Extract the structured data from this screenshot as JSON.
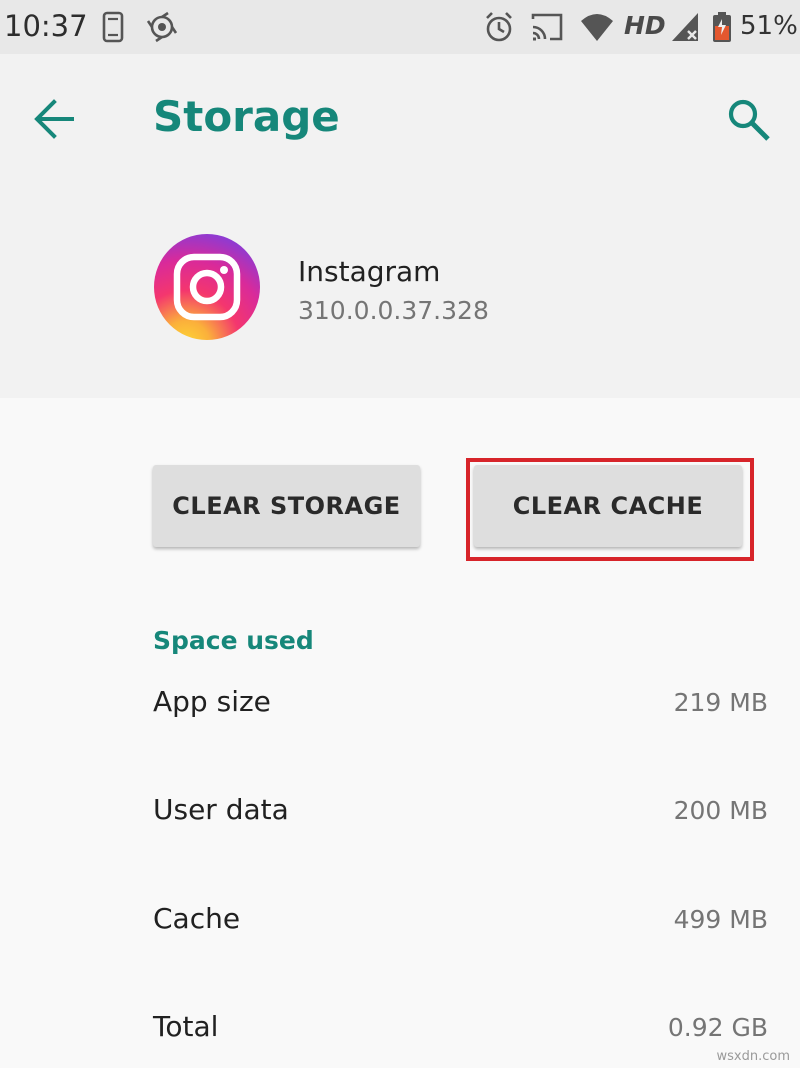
{
  "status_bar": {
    "time": "10:37",
    "network": "HD",
    "battery_percent": "51%",
    "icons": [
      "phone-icon",
      "sync-icon",
      "alarm-icon",
      "cast-icon",
      "wifi-icon",
      "cell-signal-icon",
      "battery-icon"
    ]
  },
  "header": {
    "title": "Storage",
    "back_icon": "arrow-back-icon",
    "search_icon": "search-icon"
  },
  "app": {
    "name": "Instagram",
    "version": "310.0.0.37.328",
    "icon": "instagram-icon"
  },
  "actions": {
    "clear_storage_label": "CLEAR STORAGE",
    "clear_cache_label": "CLEAR CACHE"
  },
  "space_used": {
    "header": "Space used",
    "rows": [
      {
        "label": "App size",
        "value": "219 MB"
      },
      {
        "label": "User data",
        "value": "200 MB"
      },
      {
        "label": "Cache",
        "value": "499 MB"
      },
      {
        "label": "Total",
        "value": "0.92 GB"
      }
    ]
  },
  "watermark": "wsxdn.com",
  "colors": {
    "accent": "#16877a",
    "highlight": "#d7242a",
    "button_bg": "#dedede",
    "header_bg": "#f2f2f2",
    "status_bar_bg": "#e8e8e8"
  }
}
